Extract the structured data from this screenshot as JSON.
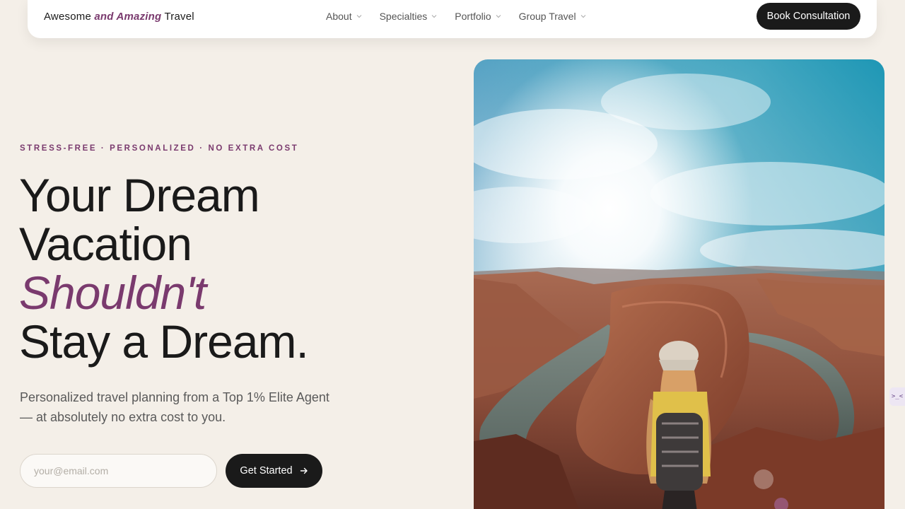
{
  "brand": {
    "prefix": "Awesome",
    "accent": "and Amazing",
    "suffix": "Travel"
  },
  "nav": {
    "items": [
      {
        "label": "About",
        "icon": "chevron-down-icon"
      },
      {
        "label": "Specialties",
        "icon": "chevron-down-icon"
      },
      {
        "label": "Portfolio",
        "icon": "chevron-down-icon"
      },
      {
        "label": "Group Travel",
        "icon": "chevron-down-icon"
      }
    ],
    "cta_label": "Book Consultation"
  },
  "hero": {
    "eyebrow": "STRESS-FREE · PERSONALIZED · NO EXTRA COST",
    "headline_line1": "Your Dream",
    "headline_line2": "Vacation",
    "headline_line3": "Shouldn't",
    "headline_line4": "Stay a Dream.",
    "subtext": "Personalized travel planning from a Top 1% Elite Agent — at absolutely no extra cost to you.",
    "email_placeholder": "your@email.com",
    "email_value": "",
    "button_label": "Get Started",
    "button_icon": "arrow-right-icon",
    "image_subject": "hiker-overlooking-canyon-photo"
  },
  "side_widget": {
    "label": ">_<"
  },
  "colors": {
    "background": "#f4efe8",
    "accent": "#7a3a6e",
    "dark": "#1a1a1a"
  }
}
